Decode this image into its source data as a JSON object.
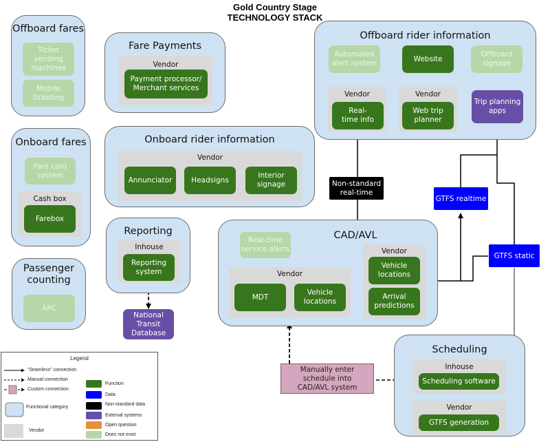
{
  "title": {
    "line1": "Gold Country Stage",
    "line2": "TECHNOLOGY STACK"
  },
  "colors": {
    "functional_category": "#cfe2f3",
    "vendor": "#d9d9d9",
    "function": "#38761d",
    "data": "#0000ff",
    "non_standard_data": "#000000",
    "external_systems": "#674ea7",
    "open_question": "#e69138",
    "does_not_exist": "#b6d7a8",
    "custom_connection": "#d5a6bd"
  },
  "categories": {
    "offboard_fares": {
      "title": "Offboard fares",
      "items": [
        "Ticket vending machines",
        "Mobile ticketing"
      ]
    },
    "onboard_fares": {
      "title": "Onboard fares",
      "fare_card": "Fare card system",
      "cash_box": "Cash box",
      "farebox": "Farebox"
    },
    "passenger_counting": {
      "title": "Passenger counting",
      "apc": "APC"
    },
    "fare_payments": {
      "title": "Fare Payments",
      "vendor": "Vendor",
      "processor": "Payment processor/ Merchant services"
    },
    "onboard_rider_info": {
      "title": "Onboard rider information",
      "vendor": "Vendor",
      "items": [
        "Annunciator",
        "Headsigns",
        "Interior signage"
      ]
    },
    "reporting": {
      "title": "Reporting",
      "inhouse": "Inhouse",
      "system": "Reporting system"
    },
    "offboard_rider_info": {
      "title": "Offboard rider information",
      "automated_alert": "Automated alert system",
      "website": "Website",
      "offboard_signage": "Offboard signage",
      "vendor1": "Vendor",
      "realtime_info": "Real-time info",
      "vendor2": "Vendor",
      "web_trip_planner": "Web trip planner",
      "trip_planning_apps": "Trip planning apps"
    },
    "cad_avl": {
      "title": "CAD/AVL",
      "service_alerts": "Real-time service alerts",
      "vendor_left": "Vendor",
      "mdt": "MDT",
      "vehicle_locations_left": "Vehicle locations",
      "vendor_right": "Vendor",
      "vehicle_locations_right": "Vehicle locations",
      "arrival_predictions": "Arrival predictions"
    },
    "scheduling": {
      "title": "Scheduling",
      "inhouse": "Inhouse",
      "software": "Scheduling software",
      "vendor": "Vendor",
      "gtfs_generation": "GTFS generation"
    }
  },
  "standalone": {
    "ntd": "National Transit Database",
    "non_standard_realtime": "Non-standard real-time",
    "gtfs_realtime": "GTFS realtime",
    "gtfs_static": "GTFS static",
    "manual_entry": "Manually enter schedule into CAD/AVL  system"
  },
  "legend": {
    "title": "Legend",
    "lines": [
      {
        "icon": "solid-arrow",
        "label": "“Seamless” connection"
      },
      {
        "icon": "dashed-arrow",
        "label": "Manual connection"
      },
      {
        "icon": "custom-connection",
        "label": "Custom connection"
      }
    ],
    "shapes": [
      {
        "icon": "functional-category",
        "label": "Functional category"
      },
      {
        "icon": "vendor",
        "label": "Vendor"
      }
    ],
    "swatches": [
      {
        "label": "Function",
        "color": "#38761d"
      },
      {
        "label": "Data",
        "color": "#0000ff"
      },
      {
        "label": "Non-standard data",
        "color": "#000000"
      },
      {
        "label": "External systems",
        "color": "#674ea7"
      },
      {
        "label": "Open question",
        "color": "#e69138"
      },
      {
        "label": "Does not exist",
        "color": "#b6d7a8"
      }
    ]
  }
}
